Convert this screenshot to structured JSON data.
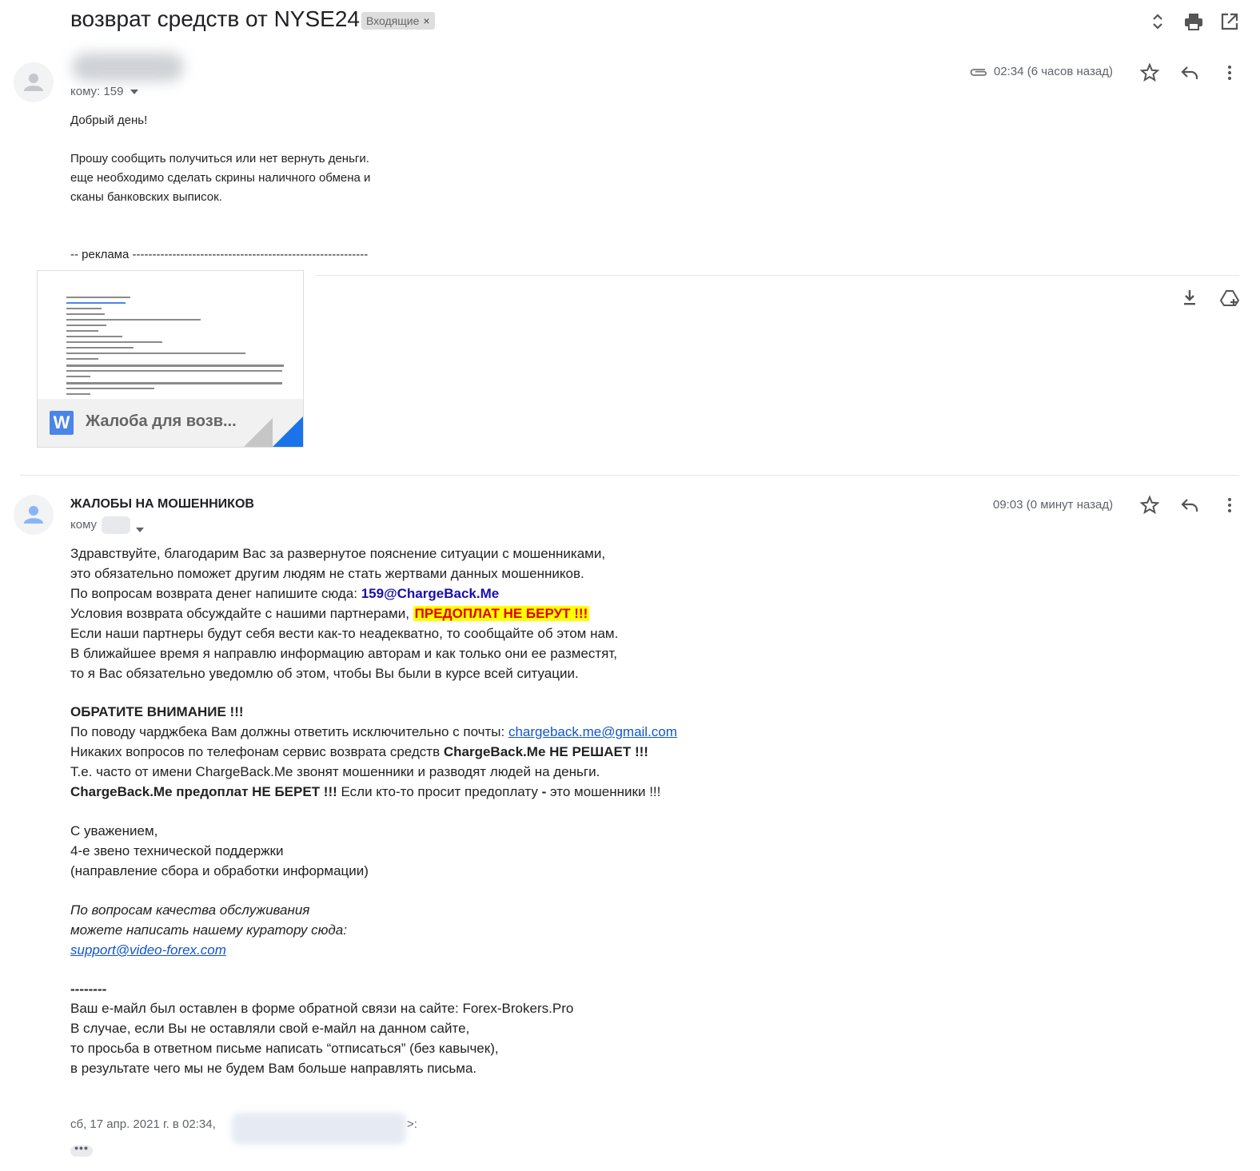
{
  "header": {
    "subject": "возврат средств от NYSE24",
    "label": "Входящие",
    "label_remove": "×",
    "icons": [
      "expand-collapse-icon",
      "print-icon",
      "open-in-new-window-icon"
    ]
  },
  "message1": {
    "to_line": "кому: 159",
    "timestamp": "02:34 (6 часов назад)",
    "body": [
      "Добрый день!",
      "Прошу сообщить получиться или нет вернуть деньги.",
      "еще необходимо сделать скрины наличного обмена и",
      "сканы банковских выписок.",
      "-- реклама -----------------------------------------------------------"
    ],
    "attachment": {
      "name": "Жалоба для возв...",
      "type_icon": "W"
    }
  },
  "message2": {
    "sender": "ЖАЛОБЫ НА МОШЕННИКОВ",
    "to_label": "кому",
    "timestamp": "09:03 (0 минут назад)",
    "lines": {
      "l1": "Здравствуйте, благодарим Вас за развернутое пояснение ситуации с мошенниками,",
      "l2": "это обязательно поможет другим людям не стать жертвами данных мошенников.",
      "l3_text": "По вопросам возврата денег напишите сюда: ",
      "l3_link": "159@ChargeBack.Me",
      "l4_text": "Условия возврата обсуждайте с нашими партнерами, ",
      "l4_highlight": "ПРЕДОПЛАТ НЕ БЕРУТ !!!",
      "l5": "Если наши партнеры будут себя вести как-то неадекватно, то сообщайте об этом нам.",
      "l6": "В ближайшее время я направлю информацию авторам и как только они ее разместят,",
      "l7": "то я Вас обязательно уведомлю об этом, чтобы Вы были в курсе всей ситуации.",
      "attention": "ОБРАТИТЕ ВНИМАНИЕ !!!",
      "l9_text": "По поводу чарджбека Вам должны ответить исключительно с почты: ",
      "l9_link": "chargeback.me@gmail.com",
      "l10_text": "Никаких вопросов по телефонам сервис возврата средств ",
      "l10_bold": "ChargeBack.Me НЕ РЕШАЕТ !!!",
      "l11": "Т.е. часто от имени ChargeBack.Me звонят мошенники и разводят людей на деньги.",
      "l12_bold": "ChargeBack.Me предоплат НЕ БЕРЕТ !!!",
      "l12_text": " Если кто-то просит предоплату ",
      "l12_dash": "-",
      "l12_end": " это мошенники !!!",
      "sig1": "С уважением,",
      "sig2": "4-е звено технической поддержки",
      "sig3": "(направление сбора и обработки информации)",
      "q1": "По вопросам качества обслуживания",
      "q2": "можете написать нашему куратору сюда:",
      "q_link": "support@video-forex.com",
      "sep": "--------",
      "f1": "Ваш е-майл был оставлен в форме обратной связи на сайте: Forex-Brokers.Pro",
      "f2": "В случае, если Вы не оставляли свой е-майл на данном сайте,",
      "f3": "то просьба в ответном письме написать “отписаться” (без кавычек),",
      "f4": "в результате чего мы не будем Вам больше направлять письма.",
      "quote": "сб, 17 апр. 2021 г. в 02:34,",
      "quote_end": ">:"
    },
    "show_trimmed": "•••"
  },
  "colors": {
    "link": "#1a0dab",
    "highlight_bg": "#ffff00",
    "highlight_text": "#e00000",
    "underline_link": "#1155cc"
  }
}
